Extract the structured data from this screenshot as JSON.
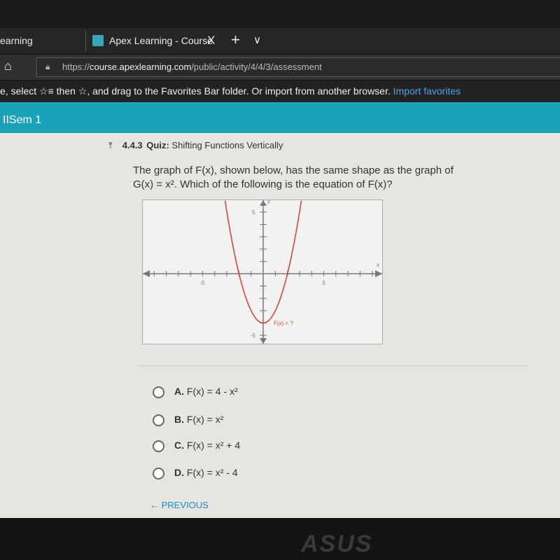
{
  "browser": {
    "prev_tab": "earning",
    "active_tab": "Apex Learning - Course",
    "close": "X",
    "new_tab": "+",
    "tab_menu": "∨",
    "url_prefix": "https://",
    "url_domain": "course.apexlearning.com",
    "url_path": "/public/activity/4/4/3/assessment",
    "favorites_msg": "e, select ☆≡ then ☆, and drag to the Favorites Bar folder. Or import from another browser.",
    "import_link": "Import favorites"
  },
  "course_bar": "IISem 1",
  "quiz": {
    "number": "4.4.3",
    "label": "Quiz:",
    "title": "Shifting Functions Vertically",
    "question_line1": "The graph of F(x), shown below, has the same shape as the graph of",
    "question_line2": "G(x) = x². Which of the following is the equation of F(x)?",
    "choices": [
      {
        "letter": "A.",
        "text": "F(x) = 4 - x²"
      },
      {
        "letter": "B.",
        "text": "F(x) = x²"
      },
      {
        "letter": "C.",
        "text": "F(x) = x² + 4"
      },
      {
        "letter": "D.",
        "text": "F(x) = x² - 4"
      }
    ],
    "previous": "PREVIOUS"
  },
  "chart_data": {
    "type": "line",
    "function": "x^2 - 4",
    "xlim": [
      -10,
      10
    ],
    "ylim": [
      -6,
      6
    ],
    "xlabel": "x",
    "ylabel": "y",
    "x_ticks_labeled": [
      "-5",
      "5"
    ],
    "y_ticks_labeled": [
      "5",
      "-5"
    ],
    "curve_label": "F(x) = ?",
    "curve_color": "#d9463a",
    "vertex": [
      0,
      -4
    ],
    "roots": [
      -2,
      2
    ]
  },
  "bezel_brand": "ASUS"
}
